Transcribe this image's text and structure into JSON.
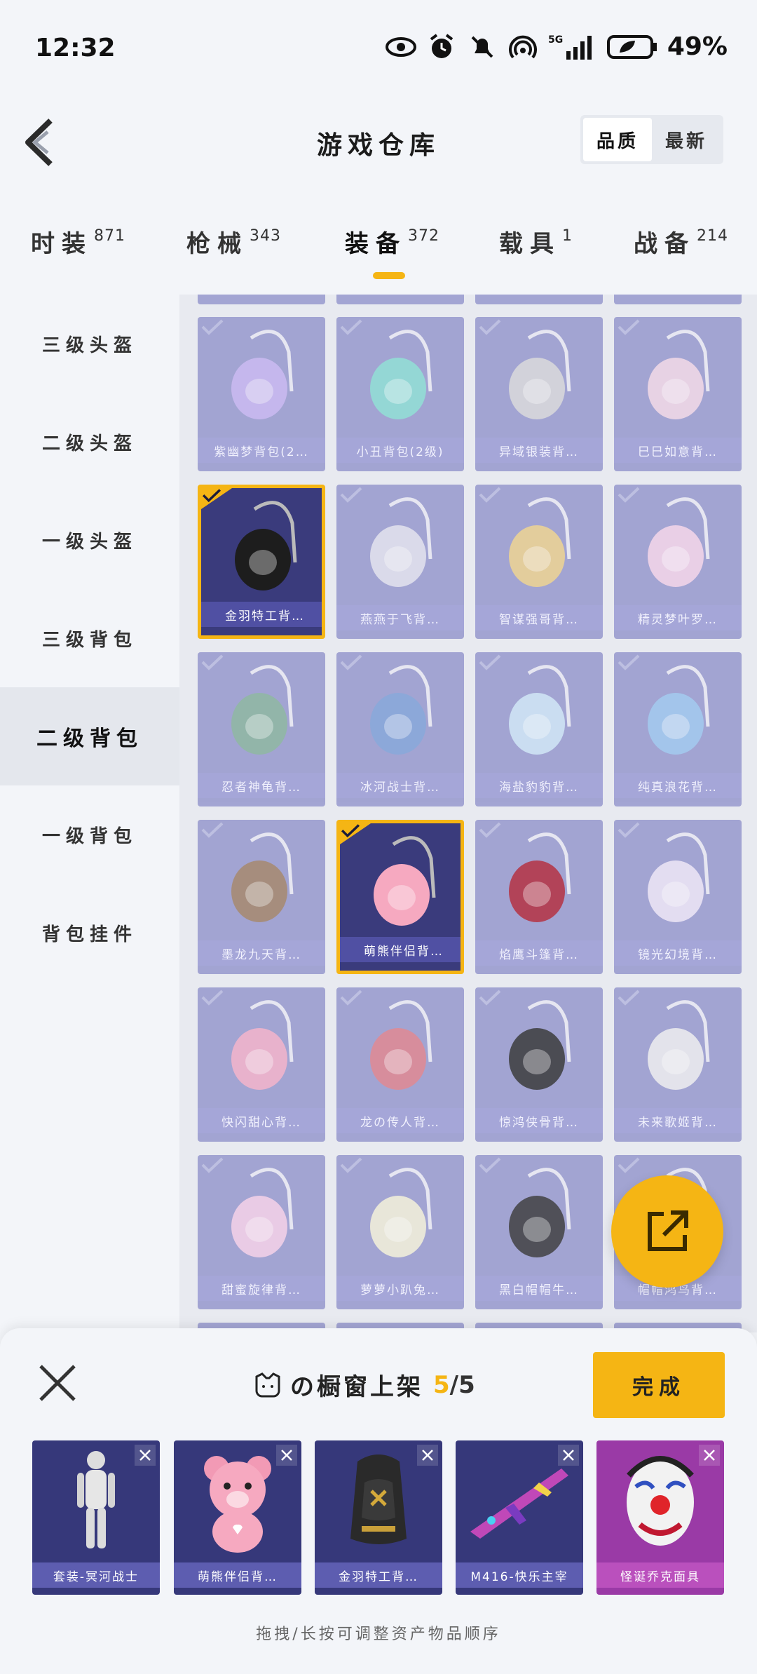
{
  "status": {
    "time": "12:32",
    "network": "5G",
    "battery": "49%"
  },
  "header": {
    "title": "游戏仓库",
    "sort": [
      "品质",
      "最新"
    ]
  },
  "tabs": [
    {
      "label": "时装",
      "count": "871"
    },
    {
      "label": "枪械",
      "count": "343"
    },
    {
      "label": "装备",
      "count": "372"
    },
    {
      "label": "载具",
      "count": "1"
    },
    {
      "label": "战备",
      "count": "214"
    }
  ],
  "sidebar": [
    "三级头盔",
    "二级头盔",
    "一级头盔",
    "三级背包",
    "二级背包",
    "一级背包",
    "背包挂件"
  ],
  "grid": [
    "紫幽梦背包(2…",
    "小丑背包(2级)",
    "异域银装背…",
    "巳巳如意背…",
    "金羽特工背…",
    "燕燕于飞背…",
    "智谋强哥背…",
    "精灵梦叶罗…",
    "忍者神龟背…",
    "冰河战士背…",
    "海盐豹豹背…",
    "纯真浪花背…",
    "墨龙九天背…",
    "萌熊伴侣背…",
    "焰鹰斗篷背…",
    "镜光幻境背…",
    "快闪甜心背…",
    "龙の传人背…",
    "惊鸿侠骨背…",
    "未来歌姬背…",
    "甜蜜旋律背…",
    "萝萝小趴兔…",
    "黑白帽帽牛…",
    "帽帽鸿鸟背…"
  ],
  "sheet": {
    "title": "の橱窗上架",
    "count": "5",
    "total": "/5",
    "done": "完成",
    "slots": [
      "套装-冥河战士",
      "萌熊伴侣背…",
      "金羽特工背…",
      "M416-快乐主宰",
      "怪诞乔克面具"
    ],
    "hint": "拖拽/长按可调整资产物品顺序"
  },
  "colors": {
    "accent": "#f5b514",
    "card": "#8a8cc6",
    "cardSelected": "#3a3b7c"
  },
  "icons": [
    "eye-icon",
    "alarm-icon",
    "mute-icon",
    "hotspot-icon",
    "signal-icon",
    "battery-icon",
    "back-icon",
    "share-icon",
    "close-icon",
    "checkmark-icon",
    "avatar-icon"
  ]
}
